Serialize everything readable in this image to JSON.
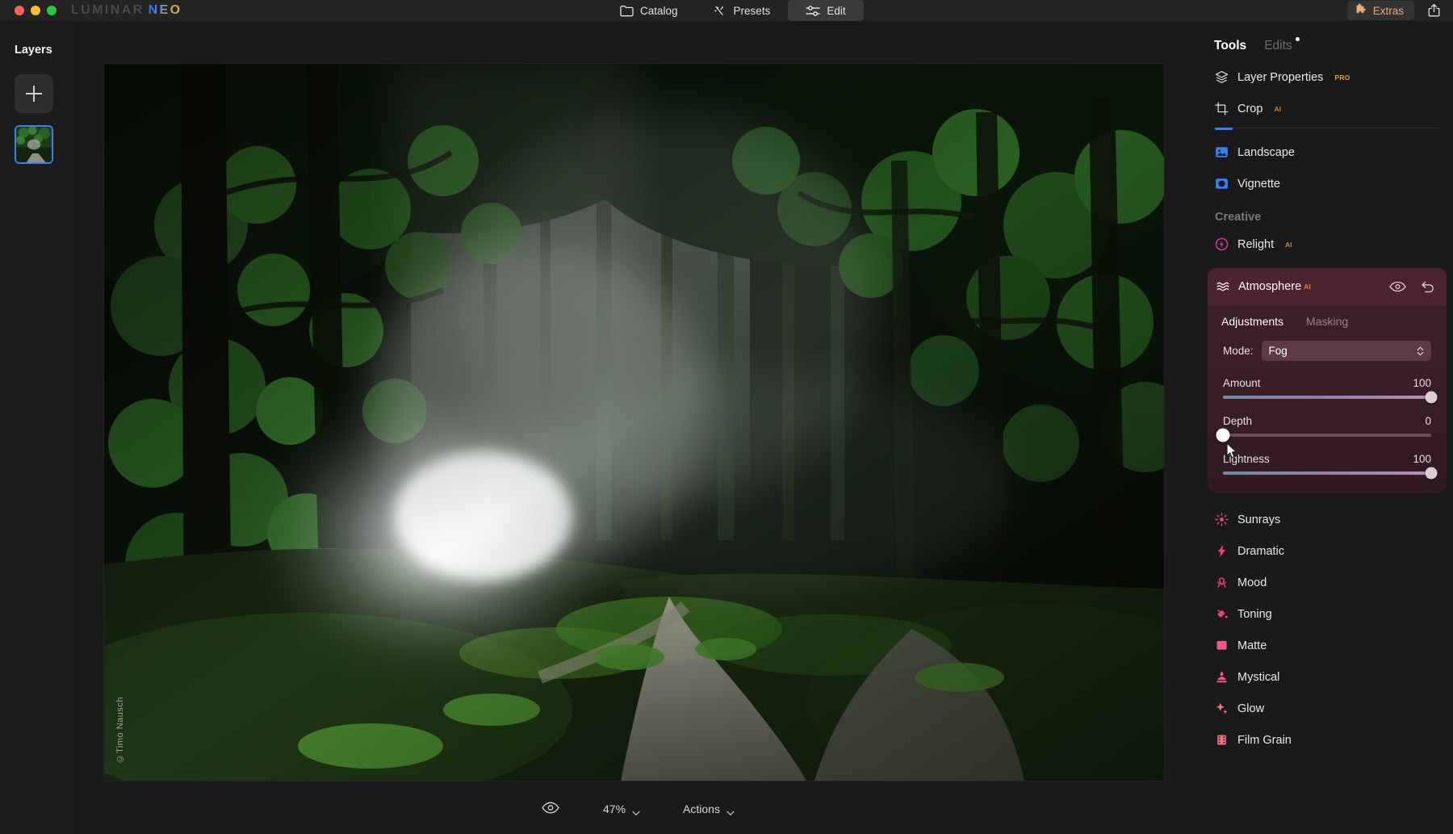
{
  "window": {
    "brand_part1": "LUMINAR",
    "brand_part2": "NEO",
    "traffic_lights": [
      "close-red",
      "minimize-yellow",
      "maximize-green"
    ]
  },
  "top_tabs": [
    {
      "label": "Catalog",
      "icon": "folder-icon",
      "active": false
    },
    {
      "label": "Presets",
      "icon": "presets-icon",
      "active": false
    },
    {
      "label": "Edit",
      "icon": "sliders-icon",
      "active": true
    }
  ],
  "top_right": {
    "extras_label": "Extras",
    "extras_icon": "puzzle-piece-icon",
    "extras_color": "#e8a877",
    "share_icon": "share-icon"
  },
  "layers": {
    "title": "Layers",
    "add_button_icon": "plus-icon",
    "thumbnail_selected": true,
    "selection_color": "#3b7ff0"
  },
  "canvas": {
    "watermark": "©Timo Nausch",
    "zoom_level": "47%",
    "actions_label": "Actions",
    "preview_icon": "eye-icon"
  },
  "tools_panel": {
    "tab_tools": "Tools",
    "tab_edits": "Edits",
    "edits_has_dot": true,
    "essentials": [
      {
        "label": "Layer Properties",
        "badge": "PRO",
        "badge_type": "pro",
        "icon": "layers-stack-icon",
        "color": "#e8e8e8"
      },
      {
        "label": "Crop",
        "badge": "AI",
        "badge_type": "ai",
        "icon": "crop-icon",
        "color": "#e8e8e8"
      }
    ],
    "accent_divider_color": "#3b7ff0",
    "blue_tools": [
      {
        "label": "Landscape",
        "badge": "",
        "icon": "landscape-icon",
        "color": "#3b7ff0"
      },
      {
        "label": "Vignette",
        "badge": "",
        "icon": "vignette-icon",
        "color": "#3b7ff0"
      }
    ],
    "creative_label": "Creative",
    "creative_top": [
      {
        "label": "Relight",
        "badge": "AI",
        "badge_type": "ai",
        "icon": "relight-icon",
        "color": "#e0309c"
      }
    ],
    "creative_rest": [
      {
        "label": "Sunrays",
        "badge": "",
        "icon": "sunrays-icon",
        "color": "#f0407f"
      },
      {
        "label": "Dramatic",
        "badge": "",
        "icon": "dramatic-bolt-icon",
        "color": "#f0407f"
      },
      {
        "label": "Mood",
        "badge": "",
        "icon": "mood-icon",
        "color": "#f0407f"
      },
      {
        "label": "Toning",
        "badge": "",
        "icon": "toning-icon",
        "color": "#f0407f"
      },
      {
        "label": "Matte",
        "badge": "",
        "icon": "matte-icon",
        "color": "#f4568b"
      },
      {
        "label": "Mystical",
        "badge": "",
        "icon": "mystical-icon",
        "color": "#f4568b"
      },
      {
        "label": "Glow",
        "badge": "",
        "icon": "glow-sparkle-icon",
        "color": "#f4707f"
      },
      {
        "label": "Film Grain",
        "badge": "",
        "icon": "film-grain-icon",
        "color": "#f4707f"
      }
    ]
  },
  "atmosphere": {
    "title": "Atmosphere",
    "badge": "AI",
    "icon": "waves-icon",
    "visibility_icon": "eye-icon",
    "reset_icon": "reset-arrow-icon",
    "panel_color": "#4b2430",
    "tabs": [
      {
        "label": "Adjustments",
        "active": true
      },
      {
        "label": "Masking",
        "active": false
      }
    ],
    "mode_label": "Mode:",
    "mode_value": "Fog",
    "mode_chevron_icon": "chevron-updown-icon",
    "sliders": [
      {
        "name": "Amount",
        "value": "100",
        "percent": 100
      },
      {
        "name": "Depth",
        "value": "0",
        "percent": 0
      },
      {
        "name": "Lightness",
        "value": "100",
        "percent": 100
      }
    ],
    "cursor_on_slider": "Depth"
  }
}
